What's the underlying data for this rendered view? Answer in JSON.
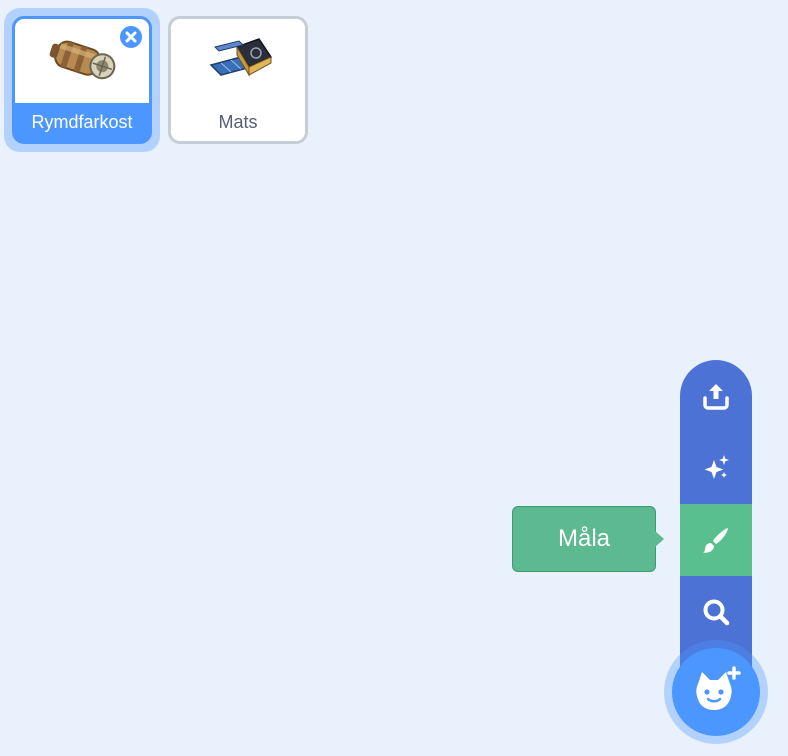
{
  "sprites": [
    {
      "name": "Rymdfarkost",
      "selected": true,
      "thumbnail": "spaceship-thumbnail"
    },
    {
      "name": "Mats",
      "selected": false,
      "thumbnail": "satellite-thumbnail"
    }
  ],
  "add_sprite_menu": {
    "items": [
      {
        "id": "upload",
        "icon": "upload-icon"
      },
      {
        "id": "surprise",
        "icon": "sparkles-icon"
      },
      {
        "id": "paint",
        "icon": "paintbrush-icon",
        "active": true
      },
      {
        "id": "search",
        "icon": "search-icon"
      }
    ],
    "tooltip": "Måla",
    "main_button_icon": "cat-plus-icon"
  },
  "colors": {
    "background": "#e9f1fc",
    "accent": "#4c97ff",
    "menu": "#4c72d6",
    "active_item": "#59bf8e"
  }
}
